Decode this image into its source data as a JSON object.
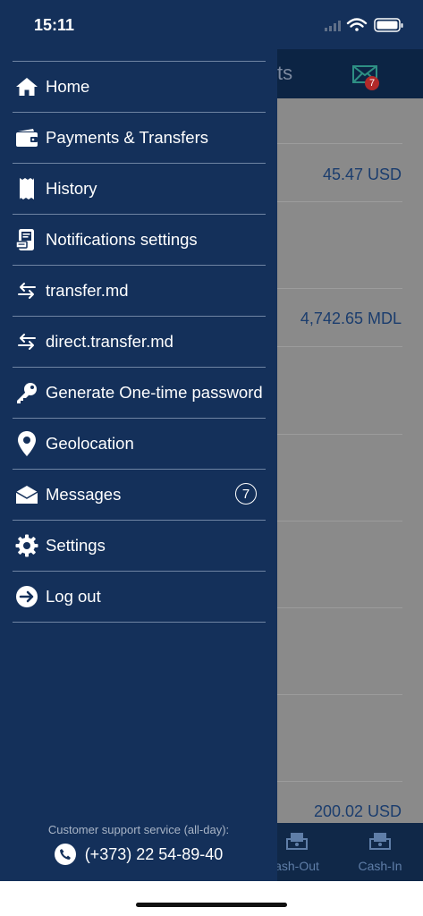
{
  "status_bar": {
    "time": "15:11"
  },
  "background_screen": {
    "header_title_fragment": "ts",
    "messages_badge_count": "7",
    "amounts": [
      "45.47 USD",
      "4,742.65 MDL",
      "200.02 USD"
    ],
    "tabs": [
      {
        "label": "ash-Out",
        "icon": "cash-out-icon"
      },
      {
        "label": "Cash-In",
        "icon": "cash-in-icon"
      }
    ]
  },
  "menu": {
    "items": [
      {
        "label": "Home",
        "icon": "home-icon"
      },
      {
        "label": "Payments & Transfers",
        "icon": "wallet-icon"
      },
      {
        "label": "History",
        "icon": "receipt-icon"
      },
      {
        "label": "Notifications settings",
        "icon": "notification-device-icon"
      },
      {
        "label": "transfer.md",
        "icon": "transfer-arrows-icon"
      },
      {
        "label": "direct.transfer.md",
        "icon": "transfer-arrows-icon"
      },
      {
        "label": "Generate One-time password",
        "icon": "key-icon"
      },
      {
        "label": "Geolocation",
        "icon": "location-pin-icon"
      },
      {
        "label": "Messages",
        "icon": "envelope-icon",
        "badge": "7"
      },
      {
        "label": "Settings",
        "icon": "gear-icon"
      },
      {
        "label": "Log out",
        "icon": "logout-icon"
      }
    ]
  },
  "support": {
    "caption": "Customer support service (all-day):",
    "phone": "(+373) 22 54-89-40"
  },
  "colors": {
    "drawer_background": "#14305a",
    "divider": "#6f84a3",
    "dimmed_content": "#8a8a8a",
    "amount_text": "#1b3d6e",
    "badge_red": "#b22a2a"
  }
}
